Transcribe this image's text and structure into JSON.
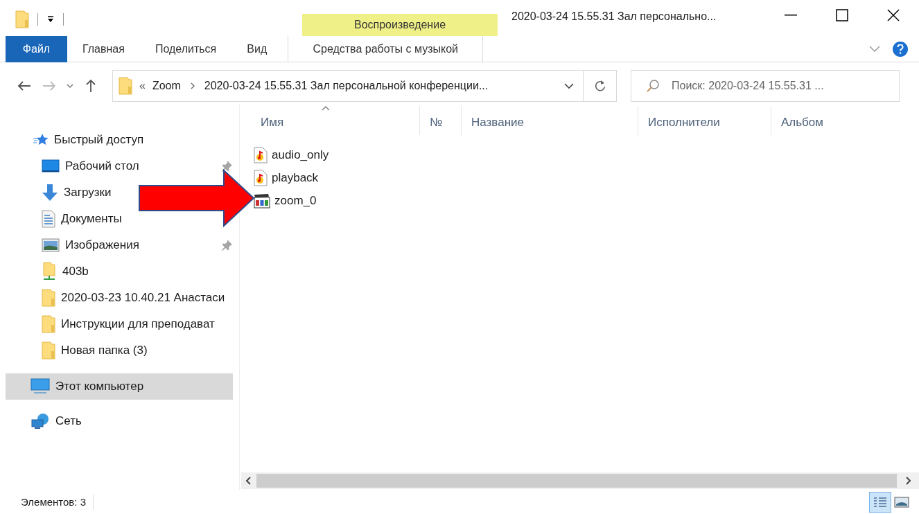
{
  "window": {
    "title": "2020-03-24 15.55.31 Зал персонально..."
  },
  "ribbon": {
    "contextual_header": "Воспроизведение",
    "tabs": [
      {
        "label": "Файл",
        "kind": "file"
      },
      {
        "label": "Главная",
        "kind": "plain"
      },
      {
        "label": "Поделиться",
        "kind": "plain"
      },
      {
        "label": "Вид",
        "kind": "plain"
      },
      {
        "label": "Средства работы с музыкой",
        "kind": "contextual"
      }
    ]
  },
  "address": {
    "overflow": "«",
    "crumbs": [
      "Zoom",
      "2020-03-24 15.55.31 Зал персональной конференции..."
    ]
  },
  "search": {
    "placeholder": "Поиск: 2020-03-24 15.55.31 ..."
  },
  "sidebar": {
    "items": [
      {
        "label": "Быстрый доступ",
        "kind": "quick",
        "pinned": false,
        "selected": false,
        "children": [
          {
            "label": "Рабочий стол",
            "kind": "desktop",
            "pinned": true,
            "selected": false
          },
          {
            "label": "Загрузки",
            "kind": "downloads",
            "pinned": false,
            "selected": false
          },
          {
            "label": "Документы",
            "kind": "documents",
            "pinned": false,
            "selected": false
          },
          {
            "label": "Изображения",
            "kind": "pictures",
            "pinned": true,
            "selected": false
          },
          {
            "label": "403b",
            "kind": "netfolder",
            "pinned": false,
            "selected": false
          },
          {
            "label": "2020-03-23 10.40.21 Анастаси",
            "kind": "folder",
            "pinned": false,
            "selected": false
          },
          {
            "label": "Инструкции для преподават",
            "kind": "folder",
            "pinned": false,
            "selected": false
          },
          {
            "label": "Новая папка (3)",
            "kind": "folder",
            "pinned": false,
            "selected": false
          }
        ]
      },
      {
        "label": "Этот компьютер",
        "kind": "computer",
        "pinned": false,
        "selected": true
      },
      {
        "label": "Сеть",
        "kind": "network",
        "pinned": false,
        "selected": false
      }
    ]
  },
  "table": {
    "columns": [
      {
        "label": "Имя",
        "sorted": true
      },
      {
        "label": "№",
        "sorted": false
      },
      {
        "label": "Название",
        "sorted": false
      },
      {
        "label": "Исполнители",
        "sorted": false
      },
      {
        "label": "Альбом",
        "sorted": false
      }
    ],
    "rows": [
      {
        "name": "audio_only",
        "kind": "audio"
      },
      {
        "name": "playback",
        "kind": "audio"
      },
      {
        "name": "zoom_0",
        "kind": "video"
      }
    ]
  },
  "status_bar": {
    "count": "Элементов: 3"
  }
}
